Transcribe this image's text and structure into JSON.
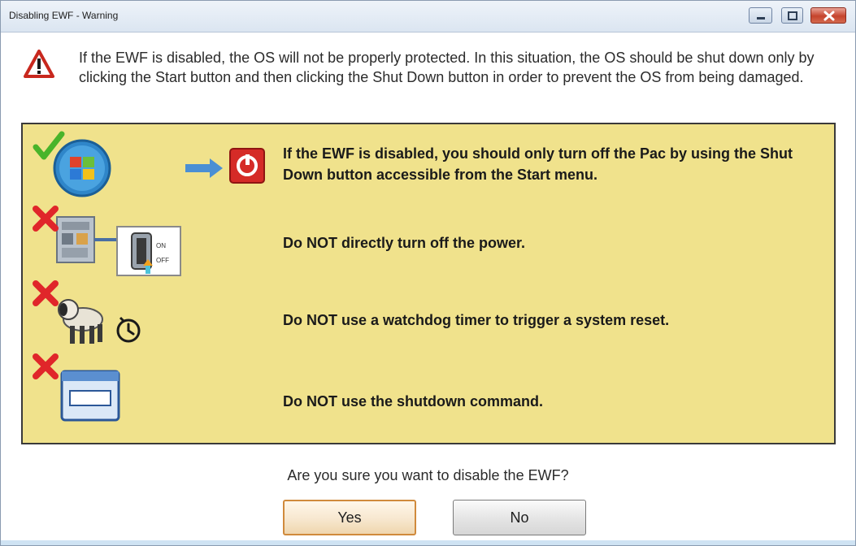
{
  "window": {
    "title": "Disabling EWF - Warning"
  },
  "warning": {
    "icon": "warning-triangle-icon",
    "message": "If the EWF is disabled, the OS will not be properly protected. In this situation, the OS should be shut down only by clicking the Start button and then clicking the Shut Down button in order to prevent the OS from being damaged."
  },
  "panel": {
    "background_color": "#f0e28c",
    "rows": [
      {
        "text": "If the EWF is disabled, you should only turn off the Pac by using the Shut Down button accessible from the Start menu.",
        "icon": "start-shutdown-icon",
        "status": "allowed"
      },
      {
        "text": "Do NOT directly turn off the power.",
        "icon": "power-switch-icon",
        "status": "forbidden",
        "switch_labels": {
          "on": "ON",
          "off": "OFF"
        }
      },
      {
        "text": "Do NOT use a watchdog timer to trigger a system reset.",
        "icon": "watchdog-timer-icon",
        "status": "forbidden"
      },
      {
        "text": "Do NOT use the shutdown command.",
        "icon": "command-window-icon",
        "status": "forbidden"
      }
    ]
  },
  "confirm": {
    "question": "Are you sure you want to disable the EWF?",
    "yes_label": "Yes",
    "no_label": "No"
  },
  "colors": {
    "allowed": "#49b42a",
    "forbidden": "#e0262a",
    "yes_focus_border": "#d08a3c"
  }
}
